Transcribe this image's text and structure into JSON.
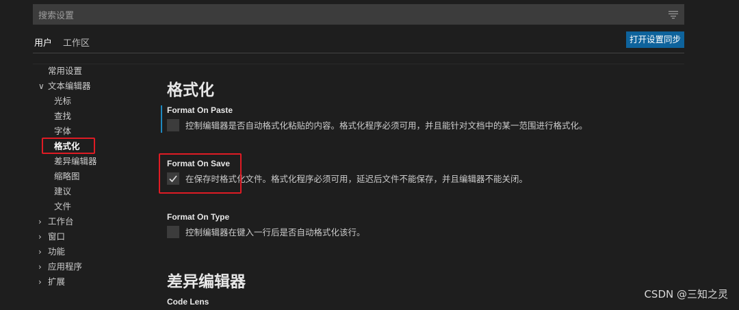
{
  "search": {
    "placeholder": "搜索设置"
  },
  "tabs": [
    {
      "label": "用户"
    },
    {
      "label": "工作区"
    }
  ],
  "sync_button": "打开设置同步",
  "toc": [
    {
      "label": "常用设置",
      "chevron": ""
    },
    {
      "label": "文本编辑器",
      "chevron": "∨"
    },
    {
      "label": "光标",
      "chevron": ""
    },
    {
      "label": "查找",
      "chevron": ""
    },
    {
      "label": "字体",
      "chevron": ""
    },
    {
      "label": "格式化",
      "chevron": ""
    },
    {
      "label": "差异编辑器",
      "chevron": ""
    },
    {
      "label": "缩略图",
      "chevron": ""
    },
    {
      "label": "建议",
      "chevron": ""
    },
    {
      "label": "文件",
      "chevron": ""
    },
    {
      "label": "工作台",
      "chevron": "›"
    },
    {
      "label": "窗口",
      "chevron": "›"
    },
    {
      "label": "功能",
      "chevron": "›"
    },
    {
      "label": "应用程序",
      "chevron": "›"
    },
    {
      "label": "扩展",
      "chevron": "›"
    }
  ],
  "sections": [
    {
      "title": "格式化"
    },
    {
      "title": "差异编辑器"
    }
  ],
  "settings": [
    {
      "name": "Format On Paste",
      "description": "控制编辑器是否自动格式化粘贴的内容。格式化程序必须可用，并且能针对文档中的某一范围进行格式化。",
      "checked": false
    },
    {
      "name": "Format On Save",
      "description": "在保存时格式化文件。格式化程序必须可用，延迟后文件不能保存，并且编辑器不能关闭。",
      "checked": true
    },
    {
      "name": "Format On Type",
      "description": "控制编辑器在键入一行后是否自动格式化该行。",
      "checked": false
    },
    {
      "name": "Code Lens",
      "description": "",
      "checked": false
    }
  ],
  "watermark": "CSDN @三知之灵",
  "colors": {
    "accent": "#0e639c",
    "highlight": "#e01b24",
    "focus": "#1f8ac0"
  }
}
